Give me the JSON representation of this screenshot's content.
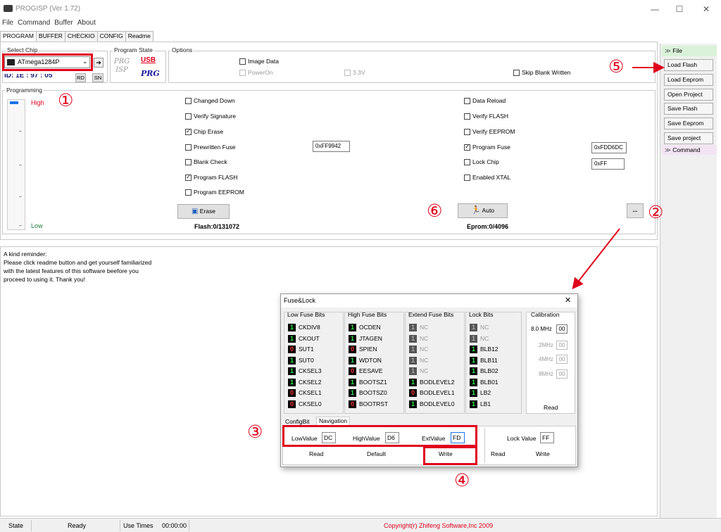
{
  "window": {
    "title": "PROGISP (Ver 1.72)",
    "minimize": "—",
    "maximize": "☐",
    "close": "✕"
  },
  "menu": [
    "File",
    "Command",
    "Buffer",
    "About"
  ],
  "tabs": [
    "PROGRAM",
    "BUFFER",
    "CHECKIO",
    "CONFIG",
    "Readme"
  ],
  "select_chip": {
    "label": "Select Chip",
    "value": "ATmega1284P",
    "id_label": "ID:",
    "id_value": "1E : 97 : 05",
    "rd": "RD",
    "sn": "SN"
  },
  "program_state": {
    "label": "Program State",
    "prg_isp": "PRG ISP",
    "usb": "USB",
    "usb_prg": "PRG"
  },
  "options": {
    "label": "Options",
    "image_data": "Image Data",
    "power_on": "PowerOn",
    "v33": "3.3V",
    "skip_blank": "Skip Blank Written"
  },
  "programming": {
    "label": "Programming",
    "high": "High",
    "low": "Low",
    "left": [
      {
        "label": "Changed Down",
        "checked": false
      },
      {
        "label": "Verify Signature",
        "checked": false
      },
      {
        "label": "Chip Erase",
        "checked": true
      },
      {
        "label": "Prewritten Fuse",
        "checked": false
      },
      {
        "label": "Blank Check",
        "checked": false
      },
      {
        "label": "Program FLASH",
        "checked": true
      },
      {
        "label": "Program EEPROM",
        "checked": false
      }
    ],
    "right": [
      {
        "label": "Data Reload",
        "checked": false
      },
      {
        "label": "Verify FLASH",
        "checked": false
      },
      {
        "label": "Verify EEPROM",
        "checked": false
      },
      {
        "label": "Program Fuse",
        "checked": true
      },
      {
        "label": "Lock Chip",
        "checked": false
      },
      {
        "label": "Enabled XTAL",
        "checked": false
      }
    ],
    "prewritten_fuse_value": "0xFF9942",
    "program_fuse_value": "0xFDD6DC",
    "lock_chip_value": "0xFF",
    "erase": "Erase",
    "auto": "Auto",
    "more": "...",
    "flash_count": "Flash:0/131072",
    "eprom_count": "Eprom:0/4096"
  },
  "log": {
    "lines": [
      "A kind reminder:",
      "Please click readme button and get yourself familiarized",
      "with the latest features of this software beefore you",
      "proceed to using it. Thank you!"
    ]
  },
  "sidebar": {
    "file": "File",
    "buttons": [
      "Load Flash",
      "Load Eeprom",
      "Open Project",
      "Save Flash",
      "Save Eeprom",
      "Save project"
    ],
    "command": "Command"
  },
  "fuse_dialog": {
    "title": "Fuse&Lock",
    "close": "✕",
    "headers": {
      "low": "Low Fuse Bits",
      "high": "High Fuse Bits",
      "ext": "Extend Fuse Bits",
      "lock": "Lock Bits",
      "cal": "Calibration"
    },
    "low_bits": [
      [
        "1",
        "CKDIV8"
      ],
      [
        "1",
        "CKOUT"
      ],
      [
        "0",
        "SUT1"
      ],
      [
        "1",
        "SUT0"
      ],
      [
        "1",
        "CKSEL3"
      ],
      [
        "1",
        "CKSEL2"
      ],
      [
        "0",
        "CKSEL1"
      ],
      [
        "0",
        "CKSEL0"
      ]
    ],
    "high_bits": [
      [
        "1",
        "OCDEN"
      ],
      [
        "1",
        "JTAGEN"
      ],
      [
        "0",
        "SPIEN"
      ],
      [
        "1",
        "WDTON"
      ],
      [
        "0",
        "EESAVE"
      ],
      [
        "1",
        "BOOTSZ1"
      ],
      [
        "1",
        "BOOTSZ0"
      ],
      [
        "0",
        "BOOTRST"
      ]
    ],
    "ext_bits": [
      [
        "1",
        "NC"
      ],
      [
        "1",
        "NC"
      ],
      [
        "1",
        "NC"
      ],
      [
        "1",
        "NC"
      ],
      [
        "1",
        "NC"
      ],
      [
        "1",
        "BODLEVEL2"
      ],
      [
        "0",
        "BODLEVEL1"
      ],
      [
        "1",
        "BODLEVEL0"
      ]
    ],
    "lock_bits": [
      [
        "1",
        "NC"
      ],
      [
        "1",
        "NC"
      ],
      [
        "1",
        "BLB12"
      ],
      [
        "1",
        "BLB11"
      ],
      [
        "1",
        "BLB02"
      ],
      [
        "1",
        "BLB01"
      ],
      [
        "1",
        "LB2"
      ],
      [
        "1",
        "LB1"
      ]
    ],
    "calibration": [
      [
        "8.0 MHz",
        "00"
      ],
      [
        "2MHz",
        "00"
      ],
      [
        "4MHz",
        "00"
      ],
      [
        "8MHz",
        "00"
      ]
    ],
    "cal_read": "Read",
    "tabs": [
      "ConfigBit",
      "Navigation"
    ],
    "low_label": "LowValue",
    "low_value": "DC",
    "high_label": "HighValue",
    "high_value": "D6",
    "ext_label": "ExtValue",
    "ext_value": "FD",
    "lock_label": "Lock Value",
    "lock_value": "FF",
    "read": "Read",
    "default": "Default",
    "write": "Write",
    "read2": "Read",
    "write2": "Write"
  },
  "annotations": {
    "n1": "①",
    "n2": "②",
    "n3": "③",
    "n4": "④",
    "n5": "⑤",
    "n6": "⑥"
  },
  "status": {
    "state": "State",
    "ready": "Ready",
    "use_times": "Use Times",
    "time": "00:00:00",
    "copyright": "Copyright(r) Zhifeng Software,Inc 2009"
  },
  "colors": {
    "accent_red": "#e0001b",
    "bit_green": "#2ff04c",
    "bit_red": "#ff3a3a"
  }
}
